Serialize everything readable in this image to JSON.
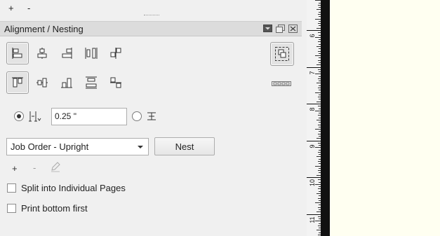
{
  "top_tools": {
    "add_label": "+",
    "remove_label": "-"
  },
  "panel": {
    "title": "Alignment / Nesting",
    "header_icons": [
      "collapse-icon",
      "float-icon",
      "close-icon"
    ],
    "alignment_row1": [
      "align-left-icon",
      "align-center-horizontal-icon",
      "align-right-icon",
      "distribute-horizontal-icon",
      "space-horizontal-icon"
    ],
    "alignment_row2": [
      "align-top-icon",
      "align-center-vertical-icon",
      "align-bottom-icon",
      "distribute-vertical-icon",
      "space-vertical-icon"
    ],
    "group_icon": "group-selection-icon",
    "indicator_icon": "spacing-indicator-icon",
    "spacing": {
      "value": "0.25 \"",
      "spacing_selected": true
    },
    "nest": {
      "selected_option": "Job Order - Upright",
      "button_label": "Nest"
    },
    "mini_tools": {
      "add_label": "+",
      "remove_label": "-"
    },
    "options": [
      {
        "label": "Split into Individual Pages",
        "checked": false
      },
      {
        "label": "Print bottom first",
        "checked": false
      }
    ]
  },
  "ruler": {
    "labels": [
      "6",
      "7",
      "8",
      "9",
      "10",
      "11"
    ]
  },
  "colors": {
    "canvas": "#fffff1",
    "panel": "#f0f0f0",
    "header": "#dcdcdc"
  }
}
